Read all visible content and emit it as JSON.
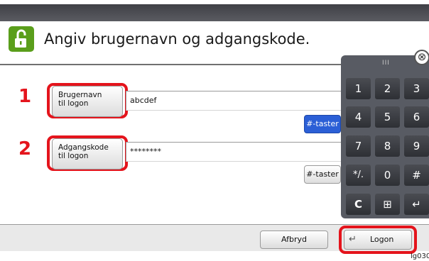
{
  "header": {
    "title": "Angiv brugernavn og adgangskode."
  },
  "fields": [
    {
      "marker": "1",
      "button_line1": "Brugernavn",
      "button_line2": "til logon",
      "value": "abcdef",
      "keys_button": "#-taster"
    },
    {
      "marker": "2",
      "button_line1": "Adgangskode",
      "button_line2": "til logon",
      "value": "********",
      "keys_button": "#-taster"
    }
  ],
  "numpad": {
    "grip": "III",
    "close": "⊗",
    "keys": [
      "1",
      "2",
      "3",
      "4",
      "5",
      "6",
      "7",
      "8",
      "9",
      "*/.",
      "0",
      "#",
      "C",
      "⊞",
      "↵"
    ]
  },
  "footer": {
    "cancel_label": "Afbryd",
    "logon_icon": "↵",
    "logon_label": "Logon"
  },
  "figure_id": "lg030",
  "colors": {
    "highlight": "#e4141c",
    "lock_icon": "#5a9e1b",
    "active_button": "#2b5fd6",
    "numpad_bg": "#585b63"
  }
}
